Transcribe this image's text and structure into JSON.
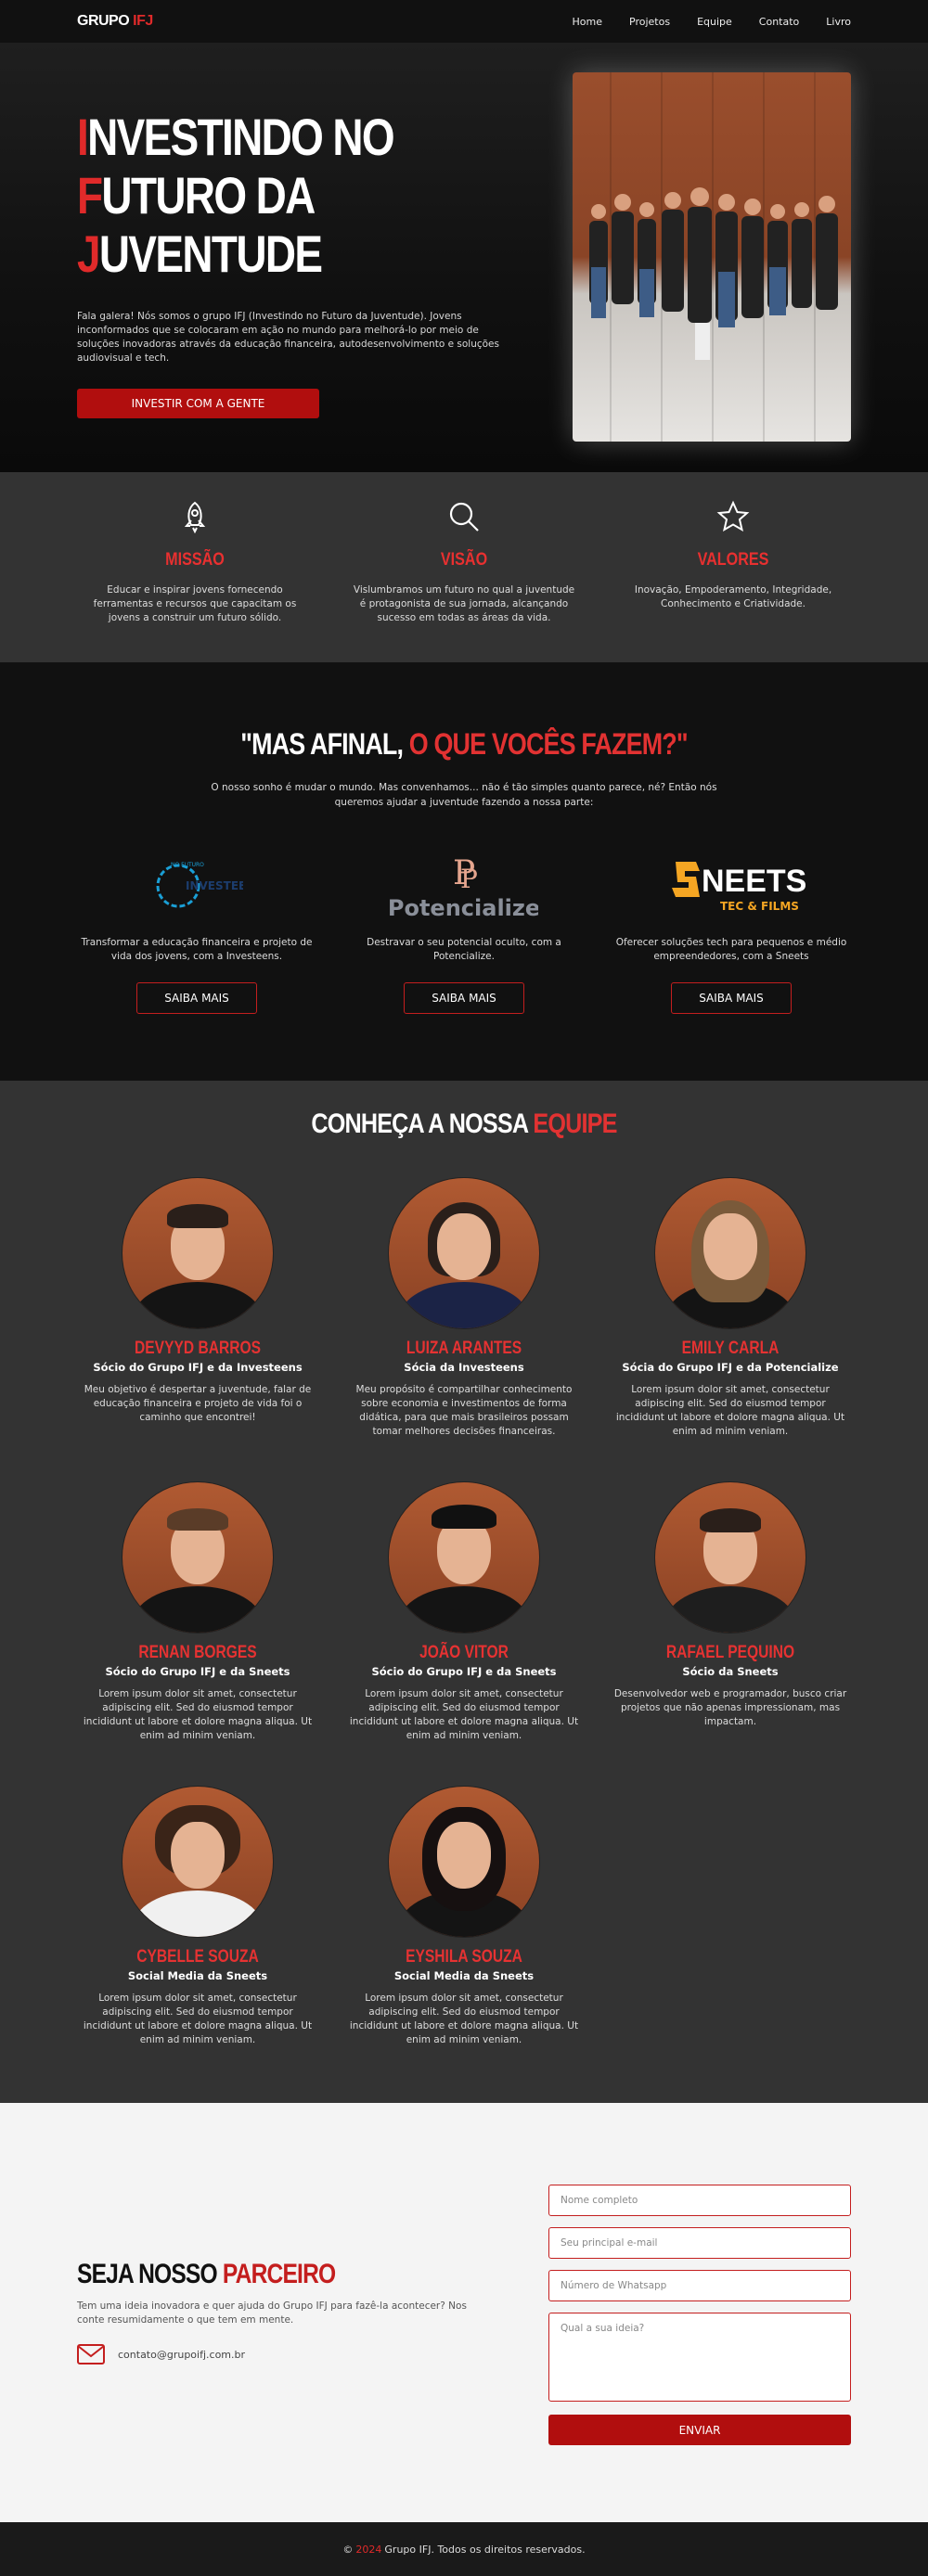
{
  "nav": {
    "logo_main": "GRUPO",
    "logo_accent": "IFJ",
    "links": [
      "Home",
      "Projetos",
      "Equipe",
      "Contato",
      "Livro"
    ]
  },
  "hero": {
    "line1_cap": "I",
    "line1_rest": "NVESTINDO NO",
    "line2_cap": "F",
    "line2_rest": "UTURO DA",
    "line3_cap": "J",
    "line3_rest": "UVENTUDE",
    "text": "Fala galera! Nós somos o grupo IFJ (Investindo no Futuro da Juventude). Jovens inconformados que se colocaram em ação no mundo para melhorá-lo por meio de soluções inovadoras através da educação financeira, autodesenvolvimento e soluções audiovisual e tech.",
    "button": "INVESTIR COM A GENTE"
  },
  "values": [
    {
      "icon": "rocket-icon",
      "title": "MISSÃO",
      "text": "Educar e inspirar jovens fornecendo ferramentas e recursos que capacitam os jovens a construir um futuro sólido."
    },
    {
      "icon": "search-icon",
      "title": "VISÃO",
      "text": "Vislumbramos um futuro no qual a juventude é protagonista de sua jornada, alcançando sucesso em todas as áreas da vida."
    },
    {
      "icon": "star-icon",
      "title": "VALORES",
      "text": "Inovação, Empoderamento, Integridade, Conhecimento e Criatividade."
    }
  ],
  "projects": {
    "title_main": "\"MAS AFINAL,",
    "title_accent": "O QUE VOCÊS FAZEM?\"",
    "subtitle": "O nosso sonho é mudar o mundo. Mas convenhamos... não é tão simples quanto parece, né? Então nós queremos ajudar a juventude fazendo a nossa parte:",
    "items": [
      {
        "logo_top": "NO FUTURO",
        "logo_main": "INVESTEENS",
        "text": "Transformar a educação financeira e projeto de vida dos jovens, com a Investeens.",
        "button": "SAIBA MAIS"
      },
      {
        "logo_main": "Potencialize",
        "text": "Destravar o seu potencial oculto, com a Potencialize.",
        "button": "SAIBA MAIS"
      },
      {
        "logo_main": "NEETS",
        "logo_sub": "TEC & FILMS",
        "text": "Oferecer soluções tech para pequenos e médio empreendedores, com a Sneets",
        "button": "SAIBA MAIS"
      }
    ]
  },
  "team": {
    "title_main": "CONHEÇA A NOSSA",
    "title_accent": "EQUIPE",
    "members": [
      {
        "name": "DEVYYD BARROS",
        "role": "Sócio do Grupo IFJ e da Investeens",
        "bio": "Meu objetivo é despertar a juventude, falar de educação financeira e projeto de vida foi o caminho que encontrei!"
      },
      {
        "name": "LUIZA ARANTES",
        "role": "Sócia da Investeens",
        "bio": "Meu propósito é compartilhar conhecimento sobre economia e investimentos de forma didática, para que mais brasileiros possam tomar melhores decisões financeiras."
      },
      {
        "name": "EMILY CARLA",
        "role": "Sócia do Grupo IFJ e da Potencialize",
        "bio": "Lorem ipsum dolor sit amet, consectetur adipiscing elit. Sed do eiusmod tempor incididunt ut labore et dolore magna aliqua. Ut enim ad minim veniam."
      },
      {
        "name": "RENAN BORGES",
        "role": "Sócio do Grupo IFJ e da Sneets",
        "bio": "Lorem ipsum dolor sit amet, consectetur adipiscing elit. Sed do eiusmod tempor incididunt ut labore et dolore magna aliqua. Ut enim ad minim veniam."
      },
      {
        "name": "JOÃO VITOR",
        "role": "Sócio do Grupo IFJ e da Sneets",
        "bio": "Lorem ipsum dolor sit amet, consectetur adipiscing elit. Sed do eiusmod tempor incididunt ut labore et dolore magna aliqua. Ut enim ad minim veniam."
      },
      {
        "name": "RAFAEL PEQUINO",
        "role": "Sócio da Sneets",
        "bio": "Desenvolvedor web e programador, busco criar projetos que não apenas impressionam, mas impactam."
      },
      {
        "name": "CYBELLE SOUZA",
        "role": "Social Media da Sneets",
        "bio": "Lorem ipsum dolor sit amet, consectetur adipiscing elit. Sed do eiusmod tempor incididunt ut labore et dolore magna aliqua. Ut enim ad minim veniam."
      },
      {
        "name": "EYSHILA SOUZA",
        "role": "Social Media da Sneets",
        "bio": "Lorem ipsum dolor sit amet, consectetur adipiscing elit. Sed do eiusmod tempor incididunt ut labore et dolore magna aliqua. Ut enim ad minim veniam."
      }
    ]
  },
  "partner": {
    "title_main": "SEJA NOSSO",
    "title_accent": "PARCEIRO",
    "text": "Tem uma ideia inovadora e quer ajuda do Grupo IFJ para fazê-la acontecer? Nos conte resumidamente o que tem em mente.",
    "email": "contato@grupoifj.com.br",
    "placeholders": {
      "name": "Nome completo",
      "email": "Seu principal e-mail",
      "whatsapp": "Número de Whatsapp",
      "idea": "Qual a sua ideia?"
    },
    "send": "ENVIAR"
  },
  "footer": {
    "prefix": "©",
    "year": "2024",
    "text": "Grupo IFJ. Todos os direitos reservados."
  },
  "colors": {
    "accent": "#e02a2a",
    "button": "#b10e0e",
    "dark": "#111111",
    "panel": "#333333"
  }
}
